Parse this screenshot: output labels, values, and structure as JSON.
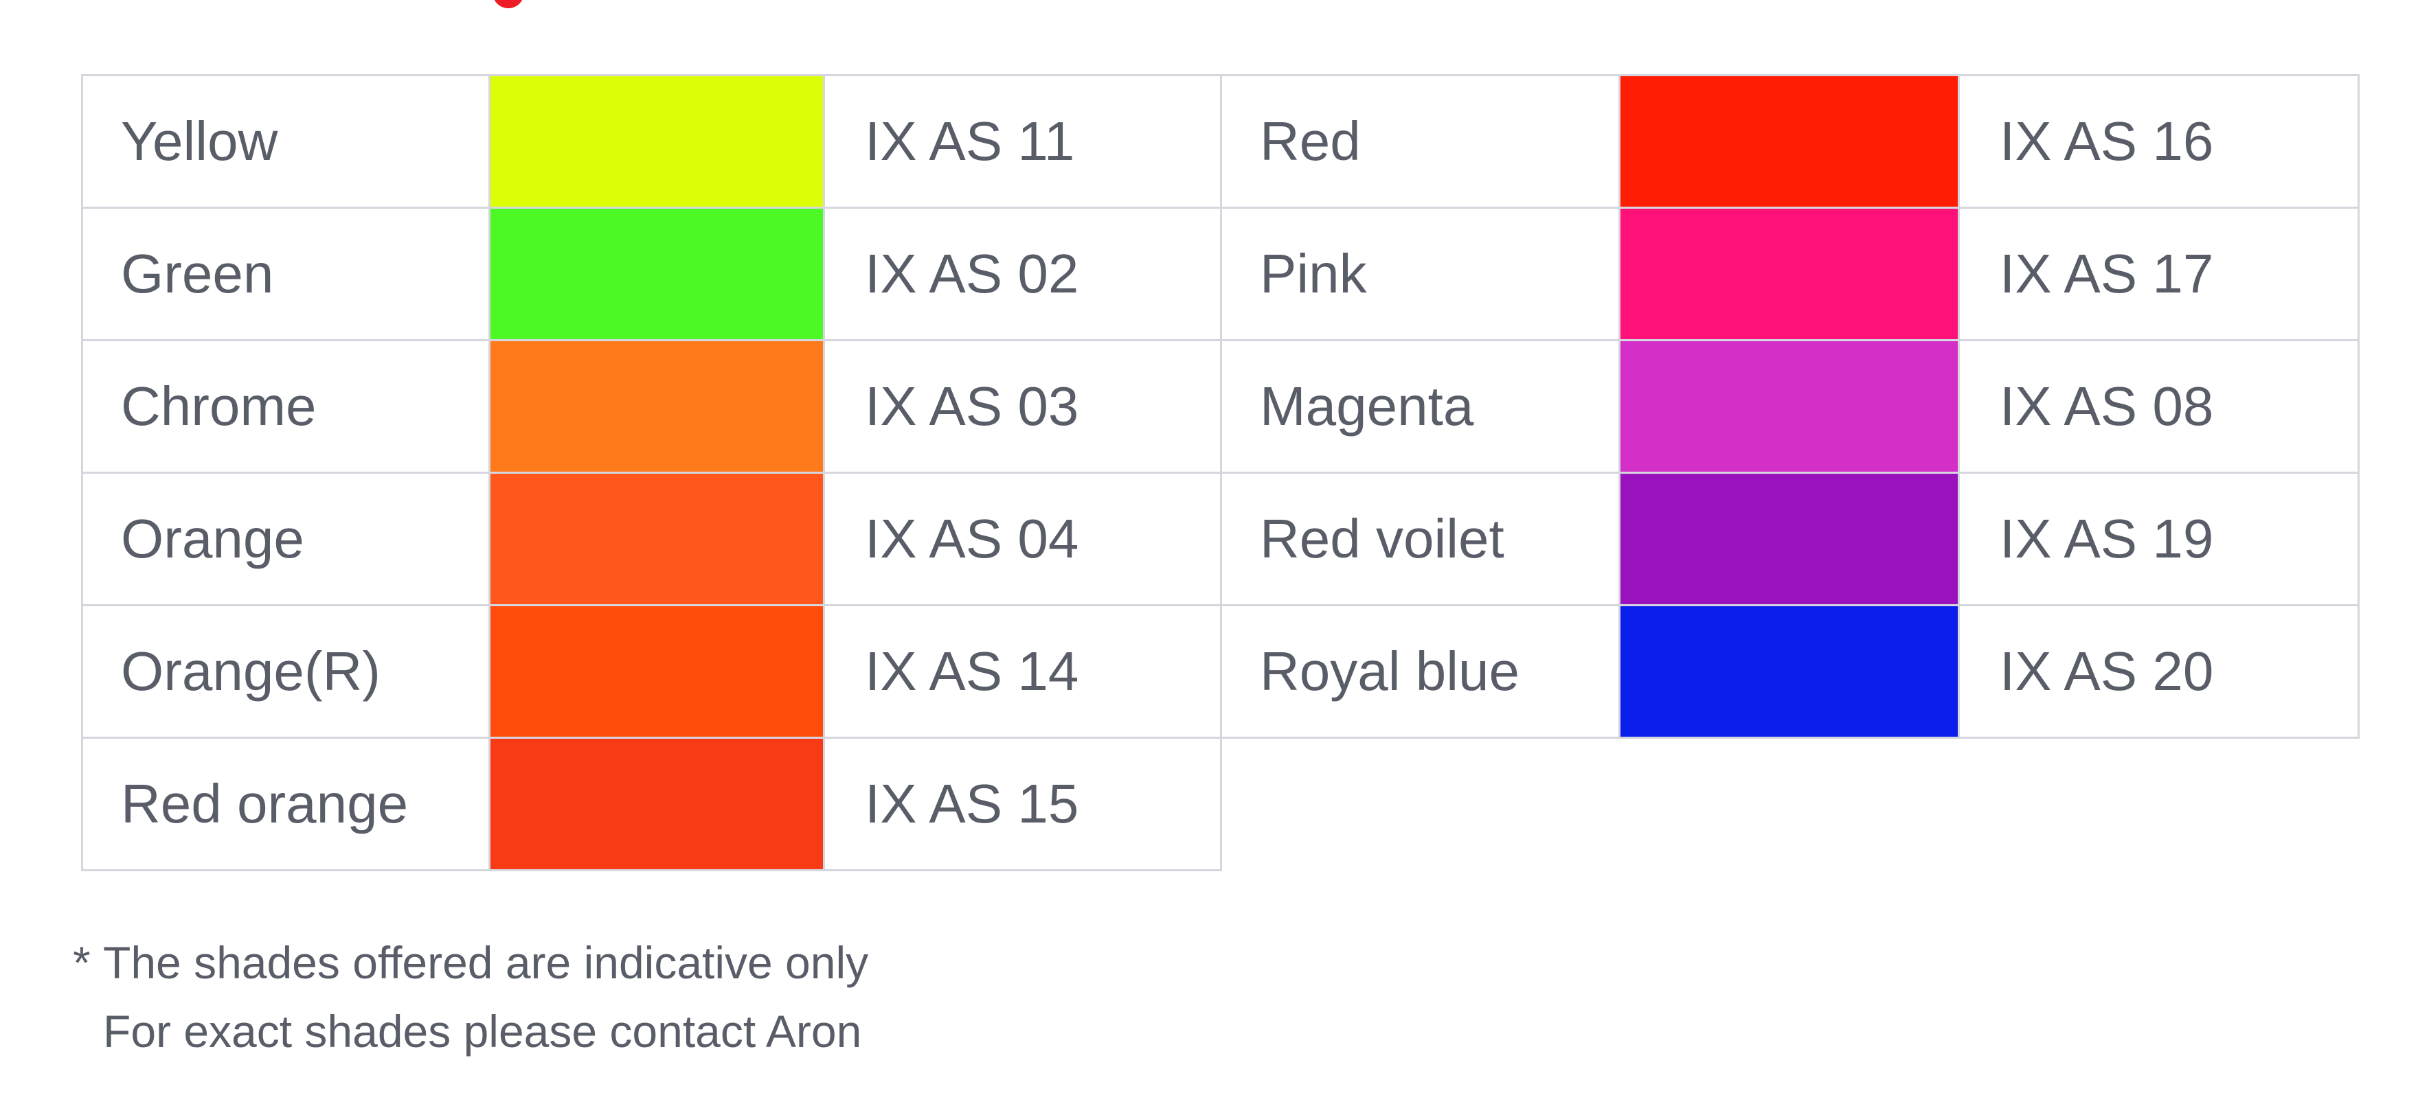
{
  "colors": {
    "text": "#585d68",
    "grid": "#d5d6de",
    "top_mark": "#ee1c25"
  },
  "shade_table": {
    "left": [
      {
        "name": "Yellow",
        "code": "IX AS 11",
        "color": "#dcff08"
      },
      {
        "name": "Green",
        "code": "IX AS 02",
        "color": "#4cf925"
      },
      {
        "name": "Chrome",
        "code": "IX AS 03",
        "color": "#ff7a1b"
      },
      {
        "name": "Orange",
        "code": "IX AS 04",
        "color": "#ff571c"
      },
      {
        "name": "Orange(R)",
        "code": "IX AS 14",
        "color": "#ff4c0b"
      },
      {
        "name": "Red orange",
        "code": "IX AS 15",
        "color": "#f93b15"
      }
    ],
    "right": [
      {
        "name": "Red",
        "code": "IX AS 16",
        "color": "#ff1e04"
      },
      {
        "name": "Pink",
        "code": "IX AS 17",
        "color": "#ff117a"
      },
      {
        "name": "Magenta",
        "code": "IX AS 08",
        "color": "#d42fc6"
      },
      {
        "name": "Red voilet",
        "code": "IX AS 19",
        "color": "#9912be"
      },
      {
        "name": "Royal blue",
        "code": "IX AS 20",
        "color": "#0c1eeb"
      }
    ]
  },
  "footnote": {
    "marker": "*",
    "line1": "The shades offered are indicative only",
    "line2": "For exact shades please contact Aron"
  }
}
